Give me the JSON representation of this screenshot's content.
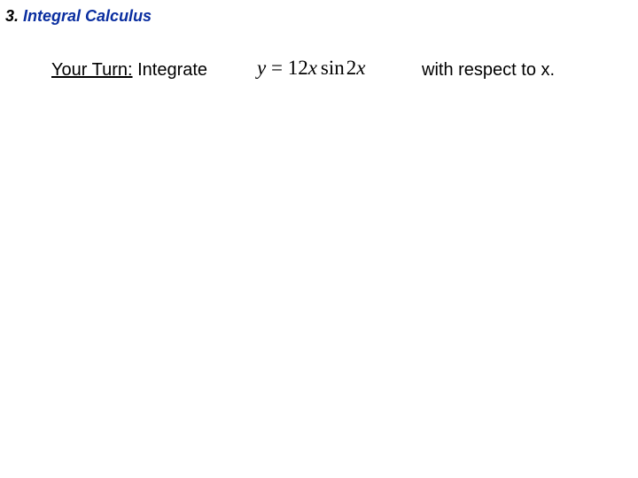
{
  "header": {
    "number": "3.",
    "title": "Integral Calculus"
  },
  "problem": {
    "your_turn_prefix": "Your Turn:",
    "instruction": " Integrate",
    "eq_lhs": "y",
    "eq_rel": "=",
    "eq_coeff": "12",
    "eq_var1": "x",
    "eq_func": "sin",
    "eq_arg_coeff": "2",
    "eq_arg_var": "x",
    "suffix": "with respect to x."
  }
}
